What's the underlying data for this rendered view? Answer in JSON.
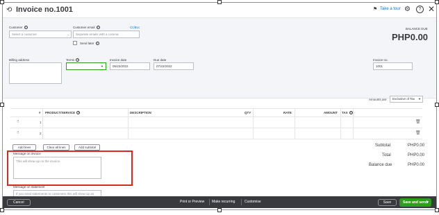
{
  "header": {
    "title": "Invoice no.1001",
    "take_tour": "Take a tour"
  },
  "customer": {
    "label": "Customer",
    "placeholder": "Select a customer"
  },
  "email": {
    "label": "Customer email",
    "placeholder": "Separate emails with a comma",
    "cc_bcc": "Cc/Bcc",
    "send_later": "Send later"
  },
  "balance": {
    "label": "BALANCE DUE",
    "amount": "PHP0.00"
  },
  "billing_address": {
    "label": "Billing address"
  },
  "terms": {
    "label": "Terms",
    "value": ""
  },
  "invoice_date": {
    "label": "Invoice date",
    "value": "06/22/2022"
  },
  "due_date": {
    "label": "Due date",
    "value": "07/22/2022"
  },
  "invoice_no": {
    "label": "Invoice no.",
    "value": "1001"
  },
  "amounts_are": {
    "label": "Amounts are",
    "value": "Exclusive of Tax"
  },
  "table": {
    "columns": [
      "#",
      "PRODUCT/SERVICE",
      "DESCRIPTION",
      "QTY",
      "RATE",
      "AMOUNT",
      "TAX"
    ],
    "rows": [
      {
        "num": "1"
      },
      {
        "num": "2"
      }
    ]
  },
  "buttons": {
    "add_lines": "Add lines",
    "clear_lines": "Clear all lines",
    "add_subtotal": "Add subtotal"
  },
  "totals": {
    "subtotal_label": "Subtotal",
    "subtotal_value": "PHP0.00",
    "total_label": "Total",
    "total_value": "PHP0.00",
    "balance_due_label": "Balance due",
    "balance_due_value": "PHP0.00"
  },
  "message_invoice": {
    "label": "Message on invoice",
    "placeholder": "This will show up on the invoice."
  },
  "message_statement": {
    "label": "Message on statement",
    "placeholder": "If you send statements to customers this will show up as"
  },
  "footer": {
    "cancel": "Cancel",
    "print_preview": "Print or Preview",
    "make_recurring": "Make recurring",
    "customise": "Customise",
    "save": "Save",
    "save_and_send": "Save and send"
  },
  "colors": {
    "highlight": "#d52b1e",
    "primary_button": "#2ca01c",
    "footer_bg": "#393a3d",
    "link": "#0077c5"
  }
}
